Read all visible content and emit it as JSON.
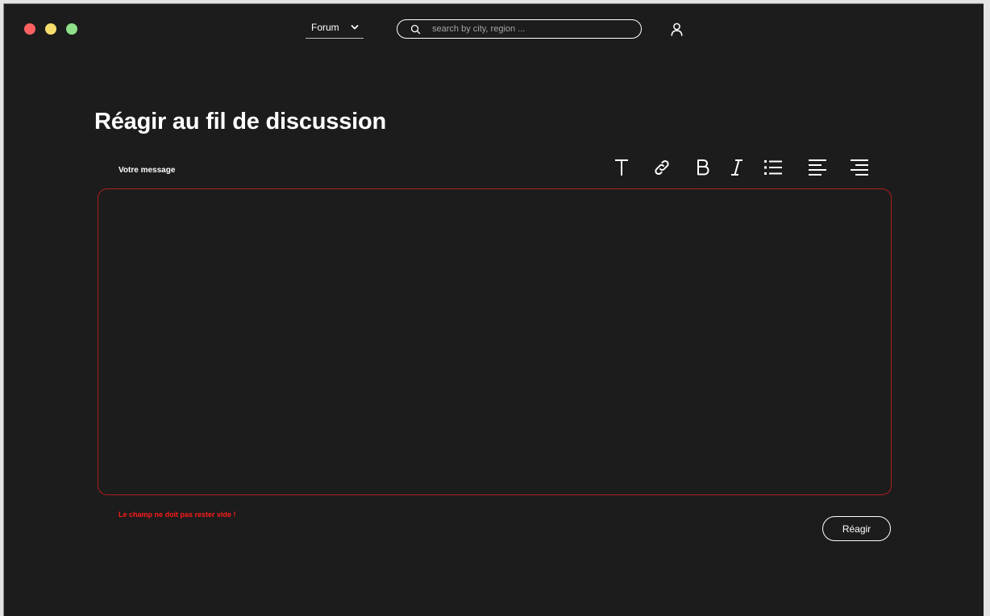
{
  "window": {
    "controls": [
      "close",
      "minimize",
      "maximize"
    ],
    "colors": {
      "close": "#ff6161",
      "minimize": "#f5dd6e",
      "maximize": "#8ee08a"
    }
  },
  "nav": {
    "forum_select": {
      "selected": "Forum",
      "icon": "chevron-down-icon"
    },
    "search": {
      "placeholder": "search by city, region ...",
      "value": "",
      "icon": "search-icon"
    },
    "user_icon": "user-icon"
  },
  "page": {
    "title": "Réagir au fil de discussion"
  },
  "form": {
    "label": "Votre message",
    "message_value": "",
    "error": "Le champ ne doit pas rester vide !",
    "submit_label": "Réagir",
    "error_color": "#ff1a1a"
  },
  "toolbar": [
    {
      "name": "text-icon"
    },
    {
      "name": "link-icon"
    },
    {
      "name": "bold-icon"
    },
    {
      "name": "italic-icon"
    },
    {
      "name": "bullet-list-icon"
    },
    {
      "name": "align-left-icon"
    },
    {
      "name": "align-right-icon"
    }
  ]
}
